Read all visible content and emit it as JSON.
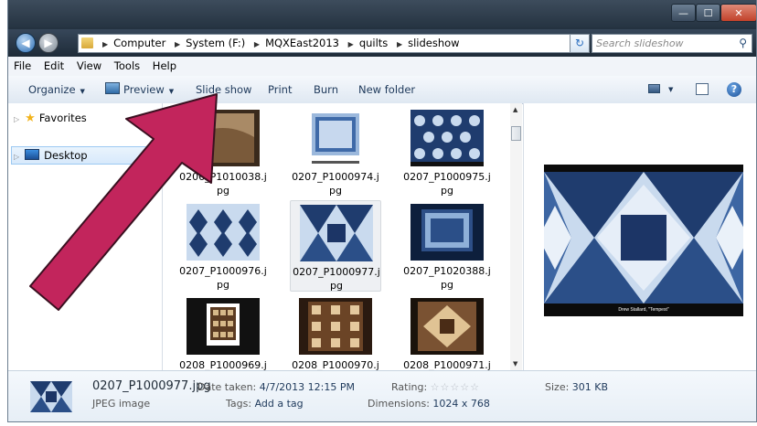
{
  "window": {
    "min_glyph": "—",
    "max_glyph": "☐",
    "close_glyph": "✕"
  },
  "address": {
    "crumbs": [
      "Computer",
      "System (F:)",
      "MQXEast2013",
      "quilts",
      "slideshow"
    ],
    "search_placeholder": "Search slideshow"
  },
  "menu": [
    "File",
    "Edit",
    "View",
    "Tools",
    "Help"
  ],
  "toolbar": {
    "organize": "Organize",
    "preview": "Preview",
    "slideshow": "Slide show",
    "print": "Print",
    "burn": "Burn",
    "new_folder": "New folder"
  },
  "nav": {
    "favorites": "Favorites",
    "desktop": "Desktop"
  },
  "files": [
    {
      "line1": "0206_P1010038.j",
      "line2": "pg",
      "style": "brown"
    },
    {
      "line1": "0207_P1000974.j",
      "line2": "pg",
      "style": "blue-framed"
    },
    {
      "line1": "0207_P1000975.j",
      "line2": "pg",
      "style": "blue-pattern"
    },
    {
      "line1": "0207_P1000976.j",
      "line2": "pg",
      "style": "blue-diamond"
    },
    {
      "line1": "0207_P1000977.j",
      "line2": "pg",
      "style": "blue-star",
      "selected": true
    },
    {
      "line1": "0207_P1020388.j",
      "line2": "pg",
      "style": "blue-hung"
    },
    {
      "line1": "0208_P1000969.j",
      "line2": "",
      "style": "dark-framed"
    },
    {
      "line1": "0208_P1000970.j",
      "line2": "",
      "style": "brown-quilt"
    },
    {
      "line1": "0208_P1000971.j",
      "line2": "",
      "style": "brown-quilt2"
    }
  ],
  "preview": {
    "caption": "Drew Stallard, \"Tempest\""
  },
  "details": {
    "filename": "0207_P1000977.jpg",
    "type": "JPEG image",
    "date_label": "Date taken:",
    "date_value": "4/7/2013 12:15 PM",
    "tags_label": "Tags:",
    "tags_value": "Add a tag",
    "rating_label": "Rating:",
    "rating_stars": "☆☆☆☆☆",
    "dims_label": "Dimensions:",
    "dims_value": "1024 x 768",
    "size_label": "Size:",
    "size_value": "301 KB"
  },
  "colors": {
    "arrow": "#c2255c",
    "quilt_dark": "#1f3c6e",
    "quilt_light": "#c9daee"
  }
}
